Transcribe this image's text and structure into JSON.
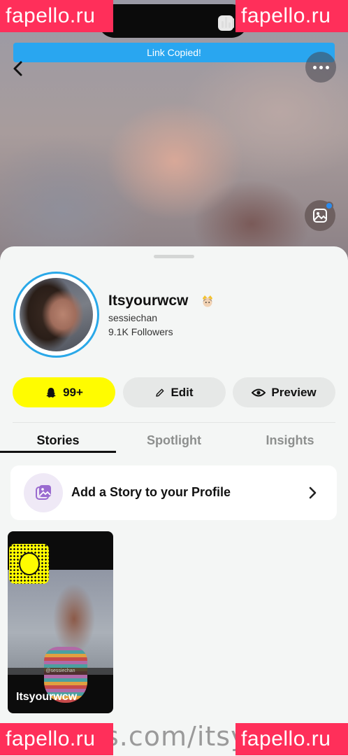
{
  "watermark": {
    "brand": "fapello.ru",
    "url_fragment": "s.com/itsy"
  },
  "toast": {
    "message": "Link Copied!"
  },
  "profile": {
    "display_name": "Itsyourwcw",
    "username": "sessiechan",
    "followers": "9.1K Followers",
    "emoji": "princess-emoji"
  },
  "actions": {
    "friends_count": "99+",
    "edit_label": "Edit",
    "preview_label": "Preview"
  },
  "tabs": [
    {
      "label": "Stories",
      "active": true
    },
    {
      "label": "Spotlight",
      "active": false
    },
    {
      "label": "Insights",
      "active": false
    }
  ],
  "add_story": {
    "label": "Add a Story to your Profile"
  },
  "story_tile": {
    "label": "Itsyourwcw",
    "tag": "@sessiechan"
  },
  "colors": {
    "snap_yellow": "#fffc00",
    "accent_blue": "#29a6f0",
    "watermark_pink": "#ff2f5a"
  },
  "icons": [
    "back-icon",
    "more-icon",
    "photo-icon",
    "ghost-icon",
    "pencil-icon",
    "eye-icon",
    "add-story-icon",
    "chevron-right-icon"
  ]
}
